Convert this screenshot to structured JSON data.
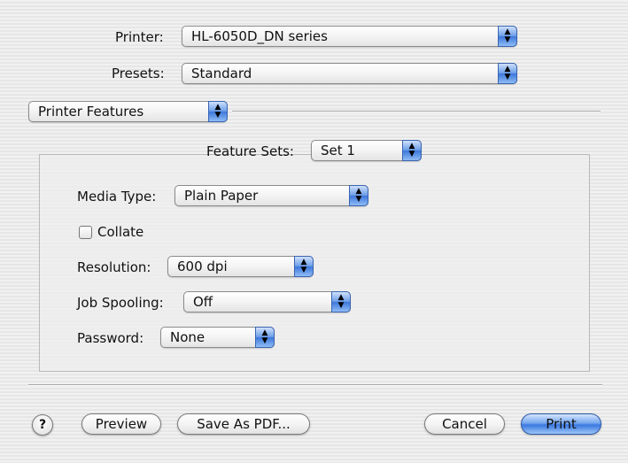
{
  "printer": {
    "label": "Printer:",
    "value": "HL-6050D_DN series"
  },
  "presets": {
    "label": "Presets:",
    "value": "Standard"
  },
  "panel_popup": {
    "value": "Printer Features"
  },
  "feature_sets": {
    "label": "Feature Sets:",
    "value": "Set 1"
  },
  "media_type": {
    "label": "Media Type:",
    "value": "Plain Paper"
  },
  "collate": {
    "label": "Collate",
    "checked": false
  },
  "resolution": {
    "label": "Resolution:",
    "value": "600 dpi"
  },
  "job_spooling": {
    "label": "Job Spooling:",
    "value": "Off"
  },
  "password": {
    "label": "Password:",
    "value": "None"
  },
  "buttons": {
    "help": "?",
    "preview": "Preview",
    "save_pdf": "Save As PDF...",
    "cancel": "Cancel",
    "print": "Print"
  },
  "icons": {
    "popup_arrows": "updown-arrows-icon",
    "help": "question-mark-icon"
  }
}
